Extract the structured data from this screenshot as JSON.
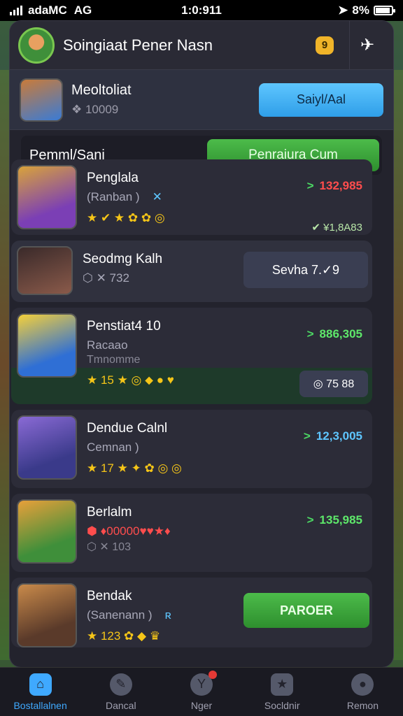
{
  "status_bar": {
    "carrier": "adaMC",
    "network": "AG",
    "time": "1:0:911",
    "battery": "8%"
  },
  "header": {
    "title": "Soingiaat Pener Nasn",
    "badge": "9",
    "icon": "share-icon"
  },
  "profile": {
    "name": "Meoltoliat",
    "sub": "❖ 10009",
    "button": "Saiyl/Aal"
  },
  "section": {
    "label": "Pemml/Sani",
    "button": "Penraiura Cum"
  },
  "cards": [
    {
      "name": "Penglala",
      "sub": "(Ranban )",
      "sub_icon": "✕",
      "stars": "★ ✔ ★ ✿ ✿ ◎",
      "value": "132,985",
      "value_color": "#ff4d4d",
      "secondary": "✔ ¥1,8A83"
    },
    {
      "name": "Seodmg Kalh",
      "sub": "⬡ ✕ 732",
      "pill": "Sevha 7.✓9"
    },
    {
      "name": "Penstiat4 10",
      "sub": "Racaao",
      "sub2": "Tmnomme",
      "stars": "★ 15 ★ ◎ ⬥ ● ♥",
      "value": "886,305",
      "value_color": "#5ee86a",
      "pill": "◎ 75 88"
    },
    {
      "name": "Dendue Calnl",
      "sub": "Cemnan )",
      "stars": "★ 17 ★ ✦ ✿ ◎ ◎",
      "value": "12,3,005",
      "value_color": "#5ec6ff"
    },
    {
      "name": "Berlalm",
      "sub": "⬢ ♦00000♥♥★♦",
      "sub2": "⬡ ✕ 103",
      "value": "135,985",
      "value_color": "#5ee86a"
    },
    {
      "name": "Bendak",
      "sub": "(Sanenann )",
      "sub_icon": "ʀ",
      "stars": "★ 123 ✿ ◆ ♛",
      "button": "PAROER"
    }
  ],
  "tabs": [
    {
      "label": "Bostallalnen",
      "icon": "home-icon",
      "active": true
    },
    {
      "label": "Dancal",
      "icon": "pencil-icon"
    },
    {
      "label": "Nger",
      "icon": "target-icon"
    },
    {
      "label": "Socldnir",
      "icon": "trophy-icon"
    },
    {
      "label": "Remon",
      "icon": "user-icon"
    }
  ]
}
